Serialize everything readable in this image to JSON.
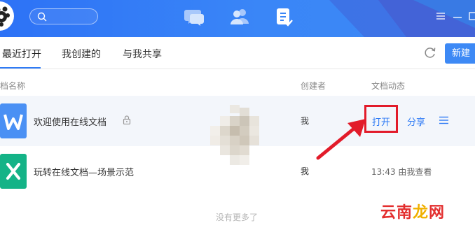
{
  "titlebar": {
    "nav": [
      {
        "icon": "chat-icon"
      },
      {
        "icon": "contacts-icon"
      },
      {
        "icon": "documents-icon",
        "active": true
      }
    ],
    "brand_color": "#2d72f6"
  },
  "tabs": {
    "items": [
      {
        "label": "最近打开",
        "active": true
      },
      {
        "label": "我创建的"
      },
      {
        "label": "与我共享"
      }
    ],
    "new_label": "新建"
  },
  "table": {
    "headers": {
      "name": "档名称",
      "creator": "创建者",
      "activity": "文档动态"
    },
    "rows": [
      {
        "title": "欢迎使用在线文档",
        "icon": "word-doc-icon",
        "creator": "我",
        "open": "打开",
        "share": "分享",
        "locked": true
      },
      {
        "title": "玩转在线文档—场景示范",
        "icon": "excel-doc-icon",
        "creator": "我",
        "activity": "13:43 由我查看"
      }
    ],
    "end_text": "没有更多了"
  },
  "watermark": {
    "text_main": "云南",
    "text_accent": "龙",
    "text_tail": "网"
  },
  "colors": {
    "accent": "#2f7bf5",
    "highlight": "#e21b2a",
    "word": "#4a90f4",
    "excel": "#14b387"
  }
}
